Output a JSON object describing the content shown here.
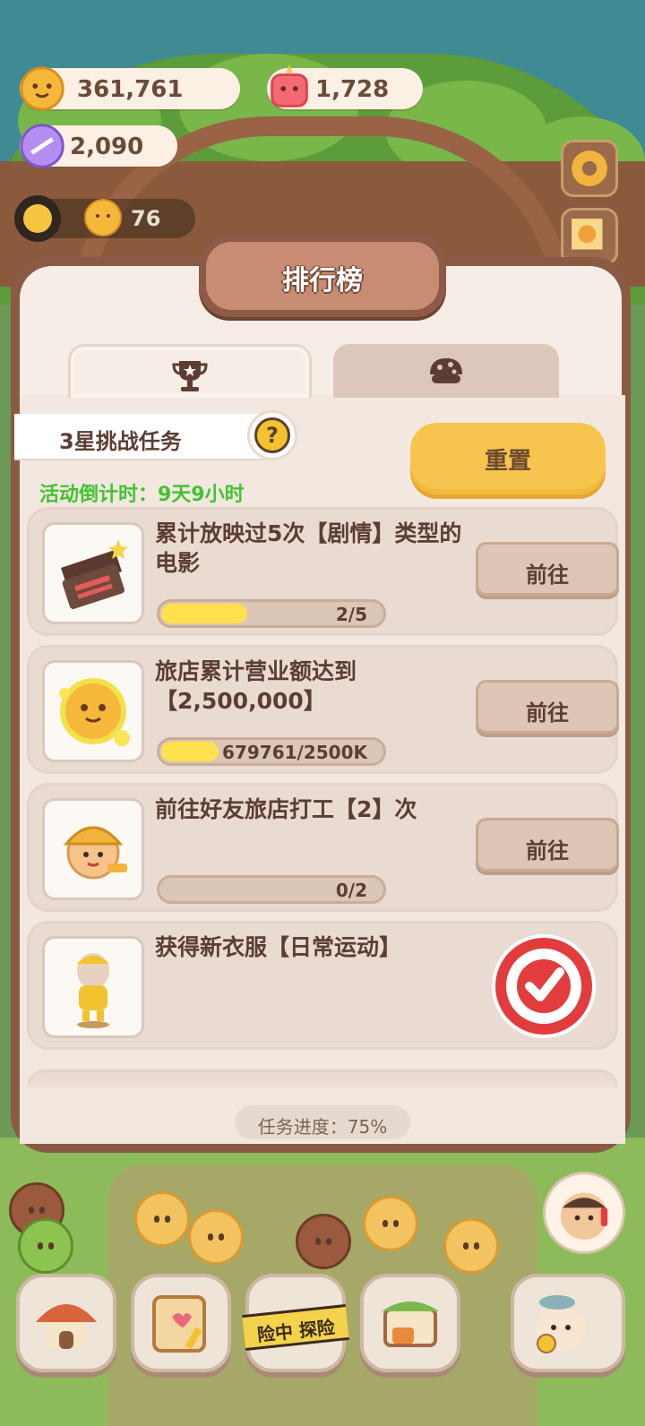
{
  "hud": {
    "coins": "361,761",
    "gems": "1,728",
    "crystals": "2,090",
    "level_count": "76"
  },
  "modal": {
    "title": "排行榜",
    "tabs": [
      {
        "icon": "trophy-icon",
        "active": true
      },
      {
        "icon": "cookie-icon",
        "active": false
      }
    ],
    "task_set_title": "3星挑战任务",
    "help_label": "?",
    "countdown": "活动倒计时：9天9小时",
    "reset_label": "重置",
    "tasks": [
      {
        "desc": "累计放映过5次【剧情】类型的电影",
        "progress_text": "2/5",
        "progress": 0.4,
        "action": "前往",
        "icon": "clapperboard-icon",
        "done": false
      },
      {
        "desc": "旅店累计营业额达到【2,500,000】",
        "progress_text": "679761/2500K",
        "progress": 0.27,
        "action": "前往",
        "icon": "coin-icon",
        "done": false
      },
      {
        "desc": "前往好友旅店打工【2】次",
        "progress_text": "0/2",
        "progress": 0.0,
        "action": "前往",
        "icon": "worker-icon",
        "done": false
      },
      {
        "desc": "获得新衣服【日常运动】",
        "icon": "outfit-icon",
        "done": true
      }
    ],
    "overall_progress": "任务进度：75%"
  },
  "bottom_nav": {
    "tape_text": "险中 探险"
  },
  "colors": {
    "accent_yellow": "#f7c54d",
    "countdown_green": "#43c233",
    "modal_frame": "#8a5a44",
    "text_brown": "#5b3e33"
  }
}
